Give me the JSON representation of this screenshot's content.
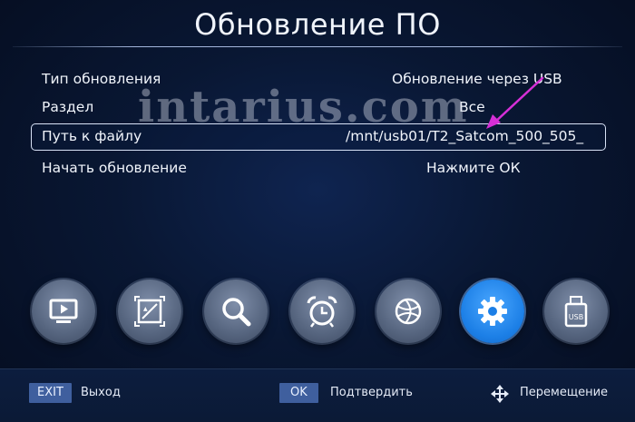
{
  "screen": {
    "title": "Обновление ПО"
  },
  "watermark": "intarius.com",
  "menu": [
    {
      "label": "Тип обновления",
      "value": "Обновление через USB",
      "selected": false
    },
    {
      "label": "Раздел",
      "value": "Все",
      "selected": false
    },
    {
      "label": "Путь к файлу",
      "value": "/mnt/usb01/T2_Satcom_500_505_",
      "selected": true
    },
    {
      "label": "Начать обновление",
      "value": "Нажмите ОК",
      "selected": false
    }
  ],
  "icons": [
    {
      "name": "tv-icon",
      "active": false
    },
    {
      "name": "picture-icon",
      "active": false
    },
    {
      "name": "search-icon",
      "active": false
    },
    {
      "name": "alarm-clock-icon",
      "active": false
    },
    {
      "name": "globe-icon",
      "active": false
    },
    {
      "name": "gear-icon",
      "active": true
    },
    {
      "name": "usb-icon",
      "active": false,
      "text": "USB"
    }
  ],
  "bottom": {
    "exit_key": "EXIT",
    "exit_label": "Выход",
    "ok_key": "OK",
    "ok_label": "Подтвердить",
    "move_label": "Перемещение"
  },
  "colors": {
    "accent": "#1c7fe6",
    "selection_border": "#d8e2f6",
    "arrow": "#d62fd6"
  }
}
